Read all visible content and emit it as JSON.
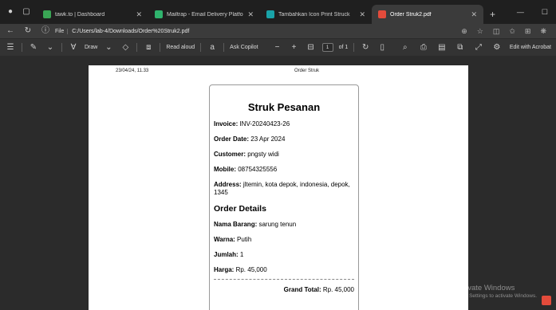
{
  "tabs": [
    {
      "title": "tawk.to | Dashboard",
      "favicon_color": "#3aa655"
    },
    {
      "title": "Mailtrap - Email Delivery Platform",
      "favicon_color": "#2fb36d"
    },
    {
      "title": "Tambahkan Icon Print Struck",
      "favicon_color": "#19a3a8"
    },
    {
      "title": "Order Struk2.pdf",
      "favicon_color": "#e34b3b"
    }
  ],
  "address": {
    "scheme_label": "File",
    "url": "C:/Users/lab-4/Downloads/Order%20Struk2.pdf"
  },
  "pdf_toolbar": {
    "draw_label": "Draw",
    "read_aloud_label": "Read aloud",
    "ask_copilot_label": "Ask Copilot",
    "page_current": "1",
    "page_total": "of 1",
    "edit_label": "Edit with Acrobat"
  },
  "page": {
    "date_header": "23/04/24, 11.33",
    "doc_header": "Order Struk"
  },
  "receipt": {
    "title": "Struk Pesanan",
    "invoice_label": "Invoice:",
    "invoice_value": " INV-20240423-26",
    "date_label": "Order Date:",
    "date_value": " 23 Apr 2024",
    "customer_label": "Customer:",
    "customer_value": " pngsty widi",
    "mobile_label": "Mobile:",
    "mobile_value": " 08754325556",
    "address_label": "Address:",
    "address_value": " jltemin, kota depok, indonesia, depok, 1345",
    "details_title": "Order Details",
    "item_label": "Nama Barang:",
    "item_value": " sarung tenun",
    "color_label": "Warna:",
    "color_value": " Putih",
    "qty_label": "Jumlah:",
    "qty_value": " 1",
    "price_label": "Harga:",
    "price_value": " Rp. 45,000",
    "total_label": "Grand Total:",
    "total_value": " Rp. 45,000"
  },
  "watermark": {
    "line1": "Activate Windows",
    "line2": "Go to Settings to activate Windows."
  },
  "colors": {
    "tabbar": "#1f1f1f",
    "toolbar": "#3b3b3b",
    "viewer_bg": "#2b2b2b",
    "pdf_accent": "#e34b3b"
  }
}
